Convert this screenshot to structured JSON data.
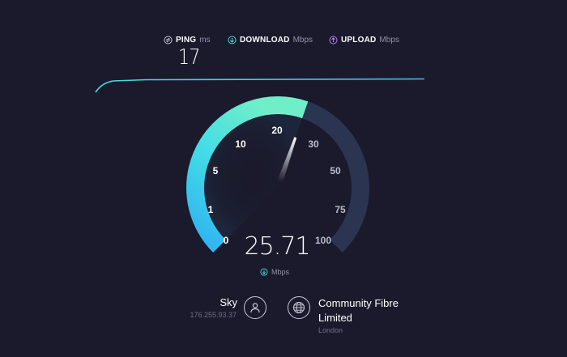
{
  "metrics": {
    "ping": {
      "label": "PING",
      "unit": "ms",
      "value": "17",
      "icon": "ping-icon"
    },
    "download": {
      "label": "DOWNLOAD",
      "unit": "Mbps",
      "icon": "download-arrow-icon"
    },
    "upload": {
      "label": "UPLOAD",
      "unit": "Mbps",
      "icon": "upload-arrow-icon"
    }
  },
  "gauge": {
    "ticks": [
      "0",
      "1",
      "5",
      "10",
      "20",
      "30",
      "50",
      "75",
      "100"
    ],
    "current_speed": "25.71",
    "unit": "Mbps",
    "needle_value": 25.71
  },
  "isp": {
    "name": "Sky",
    "ip": "176.255.93.37",
    "icon": "user-icon"
  },
  "server": {
    "name": "Community Fibre Limited",
    "location": "London",
    "icon": "globe-icon"
  },
  "colors": {
    "background": "#1a1a2c",
    "accent_cyan": "#43e1d9",
    "accent_blue": "#3ab6f2",
    "ping_icon": "#c5c7d6",
    "download_icon": "#4de0d3",
    "upload_icon": "#b77cf5",
    "track": "#2b3552"
  }
}
